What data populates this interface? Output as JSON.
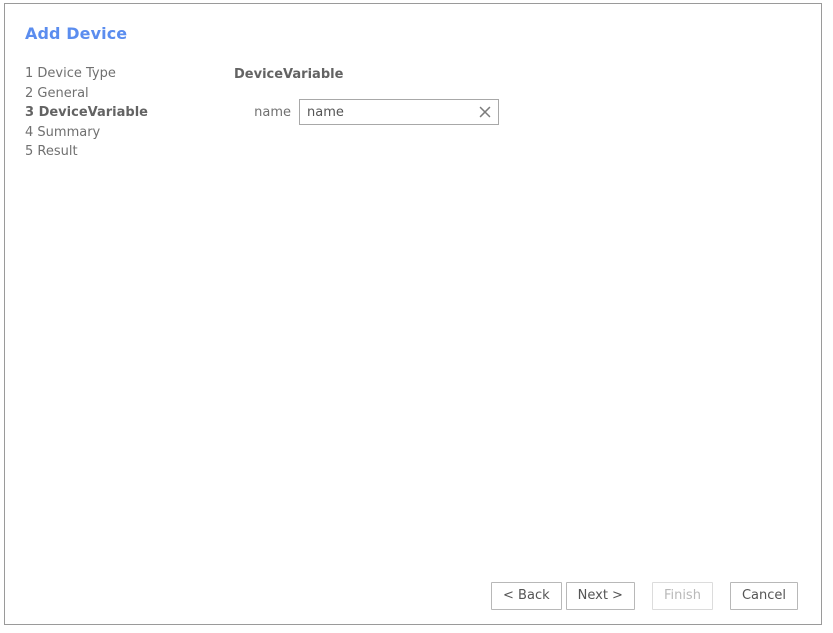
{
  "window": {
    "title": "Add Device",
    "title_color": "#5b8def",
    "border_color": "#9a9a9a"
  },
  "steps": {
    "items": [
      {
        "num": "1",
        "label": "Device Type",
        "active": false
      },
      {
        "num": "2",
        "label": "General",
        "active": false
      },
      {
        "num": "3",
        "label": "DeviceVariable",
        "active": true
      },
      {
        "num": "4",
        "label": "Summary",
        "active": false
      },
      {
        "num": "5",
        "label": "Result",
        "active": false
      }
    ]
  },
  "form": {
    "heading": "DeviceVariable",
    "fields": [
      {
        "label": "name",
        "value": "name",
        "placeholder": "name",
        "clear_icon": "close-icon"
      }
    ]
  },
  "footer": {
    "buttons": [
      {
        "label": "< Back",
        "name": "back-button",
        "disabled": false
      },
      {
        "label": "Next >",
        "name": "next-button",
        "disabled": false
      },
      {
        "label": "Finish",
        "name": "finish-button",
        "disabled": true
      },
      {
        "label": "Cancel",
        "name": "cancel-button",
        "disabled": false
      }
    ]
  }
}
